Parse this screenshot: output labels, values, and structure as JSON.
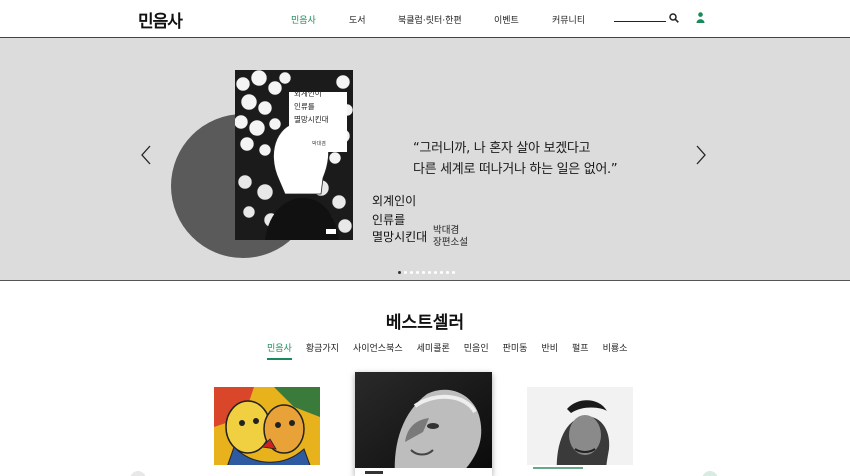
{
  "header": {
    "logo": "민음사",
    "nav": [
      "민음사",
      "도서",
      "북클럽·릿터·한편",
      "이벤트",
      "커뮤니티"
    ],
    "active_nav": "민음사",
    "search_icon": "search-icon",
    "user_icon": "user-icon",
    "accent_color": "#1a8a5a"
  },
  "hero": {
    "cover": {
      "title_lines": [
        "외계인이",
        "인류를",
        "멸망시킨대"
      ],
      "author": "박대겸"
    },
    "quote_lines": [
      "“그러니까, 나 혼자 살아 보겠다고",
      "다른 세계로 떠나거나 하는 일은 없어.”"
    ],
    "title_lines": [
      "외계인이",
      "인류를",
      "멸망시킨대"
    ],
    "author_lines": [
      "박대겸",
      "장편소설"
    ],
    "slide_count": 10,
    "active_slide": 1,
    "prev_icon": "chevron-left-icon",
    "next_icon": "chevron-right-icon"
  },
  "bestseller": {
    "title": "베스트셀러",
    "tabs": [
      "민음사",
      "황금가지",
      "사이언스북스",
      "세미콜론",
      "민음인",
      "판미동",
      "반비",
      "펄프",
      "비룡소"
    ],
    "active_tab": "민음사"
  }
}
